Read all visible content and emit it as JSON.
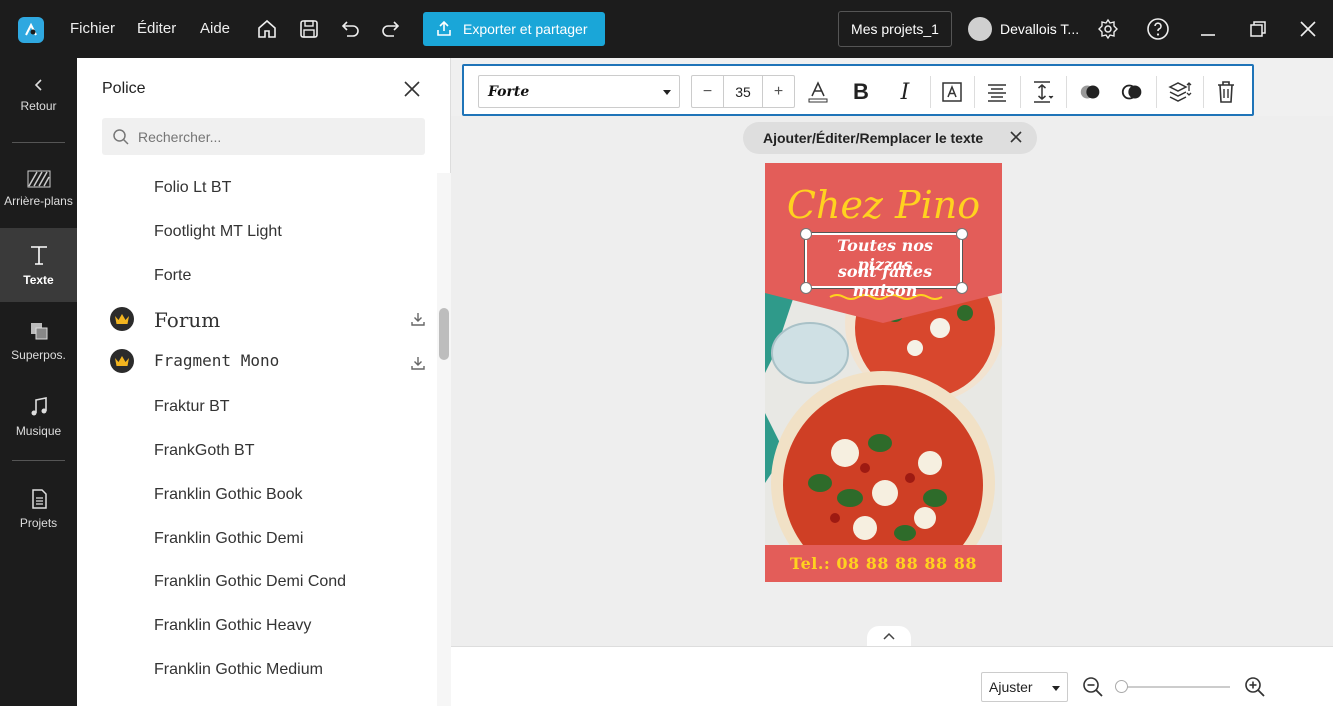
{
  "topbar": {
    "menu": [
      "Fichier",
      "Éditer",
      "Aide"
    ],
    "export_label": "Exporter et partager",
    "projects_label": "Mes projets_1",
    "username": "Devallois T..."
  },
  "rail": {
    "back": "Retour",
    "backgrounds": "Arrière-plans",
    "text": "Texte",
    "overlays": "Superpos.",
    "music": "Musique",
    "projects": "Projets"
  },
  "panel": {
    "title": "Police",
    "search_placeholder": "Rechercher...",
    "fonts": [
      "Folio Lt BT",
      "Footlight MT Light",
      "Forte",
      "Forum",
      "Fragment Mono",
      "Fraktur BT",
      "FrankGoth BT",
      "Franklin Gothic Book",
      "Franklin Gothic Demi",
      "Franklin Gothic Demi Cond",
      "Franklin Gothic Heavy",
      "Franklin Gothic Medium"
    ]
  },
  "toolbar": {
    "font_name": "Forte",
    "font_size": "35"
  },
  "canvas": {
    "hint": "Ajouter/Éditer/Remplacer le texte",
    "poster_title": "Chez Pino",
    "poster_line1": "Toutes nos pizzas",
    "poster_line2": "sont faites maison",
    "poster_phone": "Tel.: 08 88 88 88 88"
  },
  "bottombar": {
    "zoom_mode": "Ajuster"
  },
  "colors": {
    "accent": "#1aa6d8",
    "poster_bg": "#e35d59",
    "poster_yellow": "#ffd21f",
    "selection_border": "#1f74b8"
  }
}
